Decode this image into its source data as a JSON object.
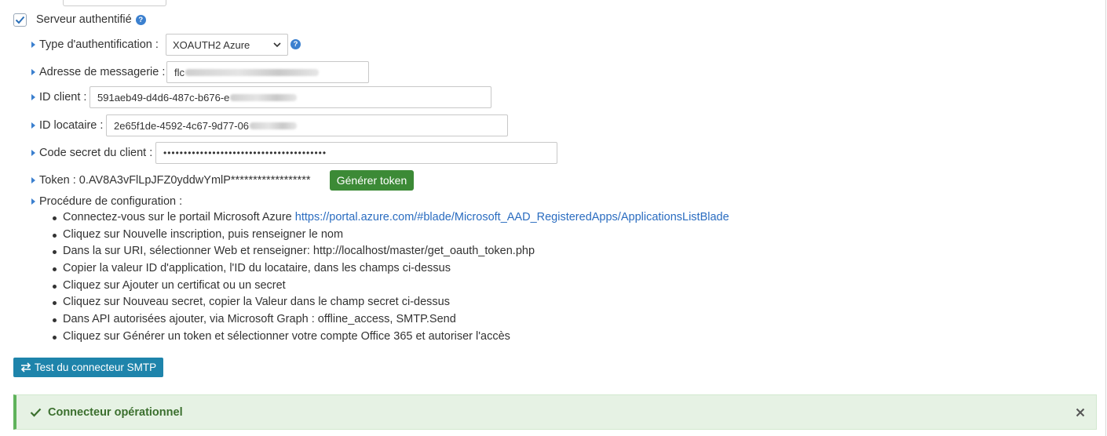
{
  "auth_server": {
    "label": "Serveur authentifié",
    "checked": true,
    "help_glyph": "?"
  },
  "fields": {
    "auth_type": {
      "label": "Type d'authentification :",
      "value": "XOAUTH2 Azure",
      "help_glyph": "?"
    },
    "email": {
      "label": "Adresse de messagerie :",
      "value_visible": "flc"
    },
    "client_id": {
      "label": "ID client :",
      "value_visible": "591aeb49-d4d6-487c-b676-e"
    },
    "tenant_id": {
      "label": "ID locataire :",
      "value_visible": "2e65f1de-4592-4c67-9d77-06"
    },
    "client_secret": {
      "label": "Code secret du client :",
      "value": "••••••••••••••••••••••••••••••••••••••••"
    }
  },
  "token": {
    "text": "Token : 0.AV8A3vFlLpJFZ0yddwYmlP******************",
    "button_label": "Générer token"
  },
  "procedure": {
    "label": "Procédure de configuration :",
    "steps": [
      {
        "text": "Connectez-vous sur le portail Microsoft Azure ",
        "link": "https://portal.azure.com/#blade/Microsoft_AAD_RegisteredApps/ApplicationsListBlade"
      },
      {
        "text": "Cliquez sur Nouvelle inscription, puis renseigner le nom"
      },
      {
        "text": "Dans la sur URI, sélectionner Web et renseigner: http://localhost/master/get_oauth_token.php"
      },
      {
        "text": "Copier la valeur ID d'application, l'ID du locataire, dans les champs ci-dessus"
      },
      {
        "text": "Cliquez sur Ajouter un certificat ou un secret"
      },
      {
        "text": "Cliquez sur Nouveau secret, copier la Valeur dans le champ secret ci-dessus"
      },
      {
        "text": "Dans API autorisées ajouter, via Microsoft Graph : offline_access, SMTP.Send"
      },
      {
        "text": "Cliquez sur Générer un token et sélectionner votre compte Office 365 et autoriser l'accès"
      }
    ]
  },
  "test_button": {
    "label": "Test du connecteur SMTP",
    "icon": "exchange-arrows-icon"
  },
  "alert": {
    "text": "Connecteur opérationnel",
    "icon": "check-icon",
    "close_icon": "close-icon"
  },
  "colors": {
    "accent": "#3b80cf",
    "green_button": "#3c8a36",
    "blue_button": "#1e84ab",
    "alert_bg": "#e6f2e4",
    "alert_text": "#3b6f2e",
    "link": "#2a6cc0"
  }
}
